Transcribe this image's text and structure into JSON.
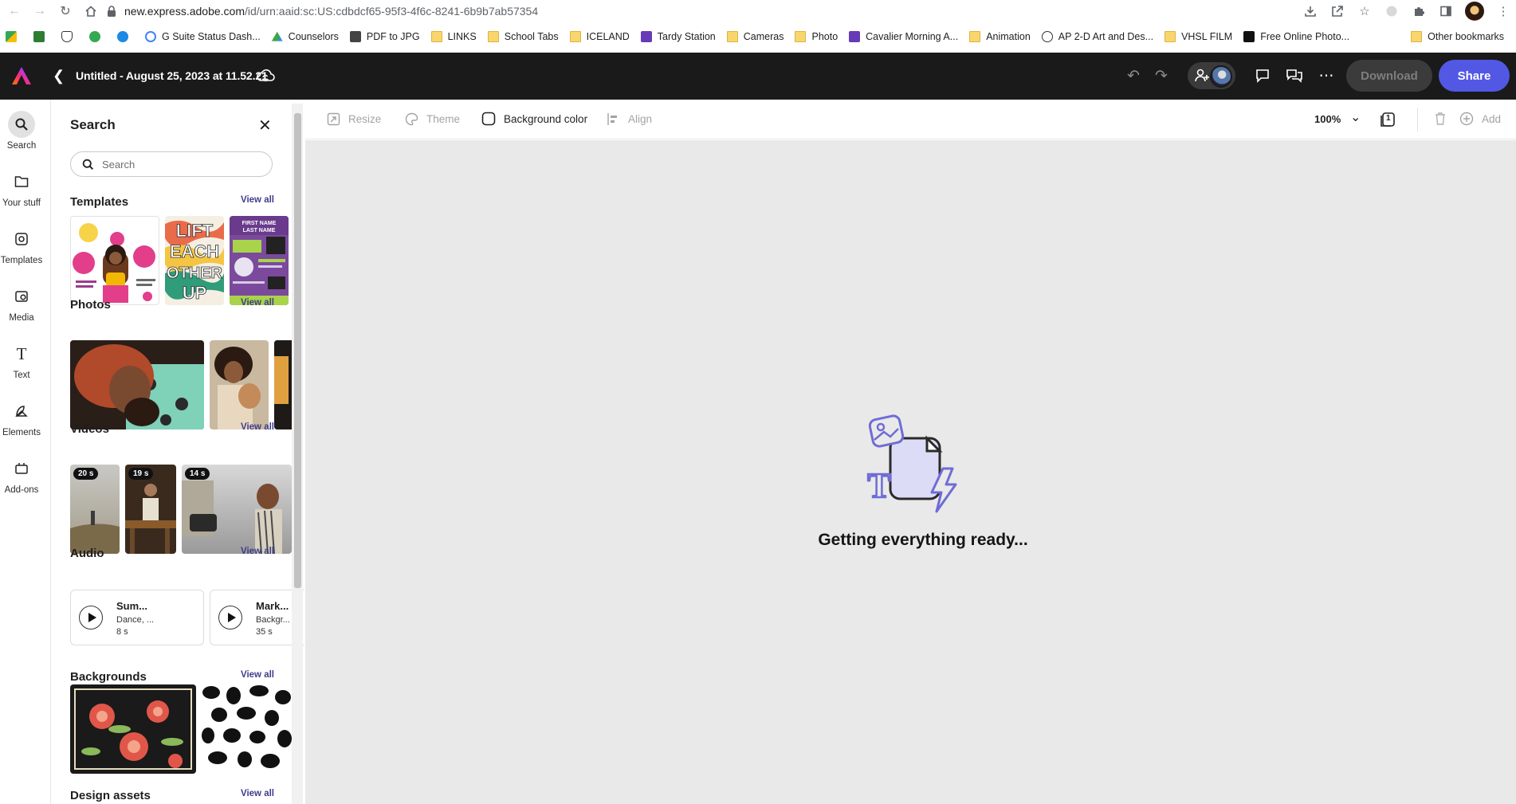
{
  "browser": {
    "url_host": "new.express.adobe.com",
    "url_path": "/id/urn:aaid:sc:US:cdbdcf65-95f3-4f6c-8241-6b9b7ab57354",
    "bookmarks": [
      {
        "label": "G Suite Status Dash...",
        "icon": "g-icon"
      },
      {
        "label": "Counselors",
        "icon": "drive-icon"
      },
      {
        "label": "PDF to JPG",
        "icon": "pdf-icon"
      },
      {
        "label": "LINKS",
        "icon": "folder-icon"
      },
      {
        "label": "School Tabs",
        "icon": "folder-icon"
      },
      {
        "label": "ICELAND",
        "icon": "folder-icon"
      },
      {
        "label": "Tardy Station",
        "icon": "form-icon"
      },
      {
        "label": "Cameras",
        "icon": "folder-icon"
      },
      {
        "label": "Photo",
        "icon": "folder-icon"
      },
      {
        "label": "Cavalier Morning A...",
        "icon": "form-icon"
      },
      {
        "label": "Animation",
        "icon": "folder-icon"
      },
      {
        "label": "AP 2-D Art and Des...",
        "icon": "globe-icon"
      },
      {
        "label": "VHSL FILM",
        "icon": "folder-icon"
      },
      {
        "label": "Free Online Photo...",
        "icon": "adobe-icon"
      }
    ],
    "other_bookmarks": "Other bookmarks"
  },
  "header": {
    "doc_title": "Untitled - August 25, 2023 at 11.52.21",
    "download_label": "Download",
    "share_label": "Share",
    "brand_color": "#5258e4"
  },
  "rail": {
    "items": [
      {
        "label": "Search",
        "icon": "search-icon"
      },
      {
        "label": "Your stuff",
        "icon": "folder-icon"
      },
      {
        "label": "Templates",
        "icon": "templates-icon"
      },
      {
        "label": "Media",
        "icon": "media-icon"
      },
      {
        "label": "Text",
        "icon": "text-icon"
      },
      {
        "label": "Elements",
        "icon": "elements-icon"
      },
      {
        "label": "Add-ons",
        "icon": "addons-icon"
      }
    ]
  },
  "panel": {
    "title": "Search",
    "search_placeholder": "Search",
    "view_all": "View all",
    "sections": {
      "templates": "Templates",
      "photos": "Photos",
      "videos": "Videos",
      "audio": "Audio",
      "backgrounds": "Backgrounds",
      "design_assets": "Design assets"
    },
    "videos": [
      {
        "duration": "20 s"
      },
      {
        "duration": "19 s"
      },
      {
        "duration": "14 s"
      }
    ],
    "audio": [
      {
        "title": "Sum...",
        "subtitle": "Dance, ...",
        "duration": "8 s"
      },
      {
        "title": "Mark...",
        "subtitle": "Backgr...",
        "duration": "35 s"
      }
    ]
  },
  "toolbar": {
    "resize": "Resize",
    "theme": "Theme",
    "background_color": "Background color",
    "align": "Align",
    "zoom": "100%",
    "page_count": "1",
    "add": "Add"
  },
  "canvas": {
    "loading_text": "Getting everything ready..."
  }
}
